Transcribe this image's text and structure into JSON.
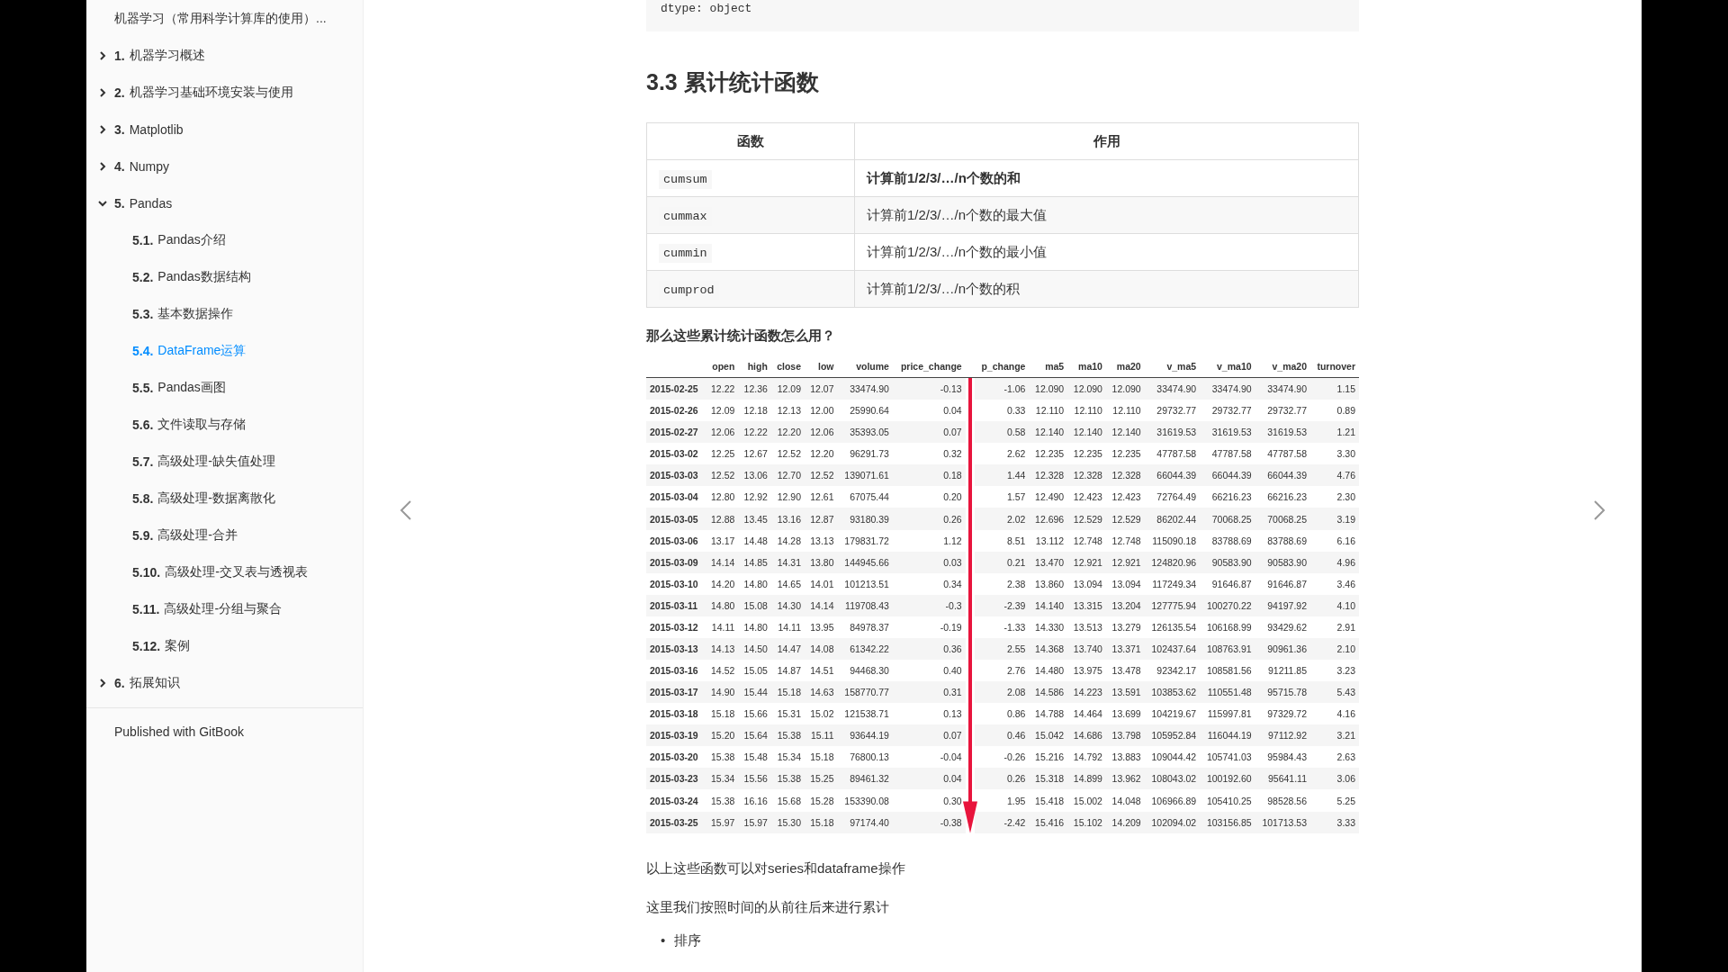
{
  "sidebar": {
    "header": "机器学习（常用科学计算库的使用）...",
    "items": [
      {
        "number": "1.",
        "label": "机器学习概述",
        "expanded": false,
        "selected": false
      },
      {
        "number": "2.",
        "label": "机器学习基础环境安装与使用",
        "expanded": false,
        "selected": false
      },
      {
        "number": "3.",
        "label": "Matplotlib",
        "expanded": false,
        "selected": false
      },
      {
        "number": "4.",
        "label": "Numpy",
        "expanded": false,
        "selected": false
      },
      {
        "number": "5.",
        "label": "Pandas",
        "expanded": true,
        "selected": false,
        "children": [
          {
            "number": "5.1.",
            "label": "Pandas介绍",
            "selected": false
          },
          {
            "number": "5.2.",
            "label": "Pandas数据结构",
            "selected": false
          },
          {
            "number": "5.3.",
            "label": "基本数据操作",
            "selected": false
          },
          {
            "number": "5.4.",
            "label": "DataFrame运算",
            "selected": true
          },
          {
            "number": "5.5.",
            "label": "Pandas画图",
            "selected": false
          },
          {
            "number": "5.6.",
            "label": "文件读取与存储",
            "selected": false
          },
          {
            "number": "5.7.",
            "label": "高级处理-缺失值处理",
            "selected": false
          },
          {
            "number": "5.8.",
            "label": "高级处理-数据离散化",
            "selected": false
          },
          {
            "number": "5.9.",
            "label": "高级处理-合并",
            "selected": false
          },
          {
            "number": "5.10.",
            "label": "高级处理-交叉表与透视表",
            "selected": false
          },
          {
            "number": "5.11.",
            "label": "高级处理-分组与聚合",
            "selected": false
          },
          {
            "number": "5.12.",
            "label": "案例",
            "selected": false
          }
        ]
      },
      {
        "number": "6.",
        "label": "拓展知识",
        "expanded": false,
        "selected": false
      }
    ],
    "footer": "Published with GitBook"
  },
  "content": {
    "code": "dtype: object",
    "heading": "3.3 累计统计函数",
    "function_table": {
      "columns": [
        "函数",
        "作用"
      ],
      "rows": [
        {
          "function": "cumsum",
          "description": "计算前1/2/3/…/n个数的和",
          "bold": true
        },
        {
          "function": "cummax",
          "description": "计算前1/2/3/…/n个数的最大值",
          "bold": false
        },
        {
          "function": "cummin",
          "description": "计算前1/2/3/…/n个数的最小值",
          "bold": false
        },
        {
          "function": "cumprod",
          "description": "计算前1/2/3/…/n个数的积",
          "bold": false
        }
      ]
    },
    "question": "那么这些累计统计函数怎么用？",
    "dataframe": {
      "columns": [
        "open",
        "high",
        "close",
        "low",
        "volume",
        "price_change",
        "p_change",
        "ma5",
        "ma10",
        "ma20",
        "v_ma5",
        "v_ma10",
        "v_ma20",
        "turnover"
      ],
      "rows": [
        {
          "index": "2015-02-25",
          "cells": [
            "12.22",
            "12.36",
            "12.09",
            "12.07",
            "33474.90",
            "-0.13",
            "-1.06",
            "12.090",
            "12.090",
            "12.090",
            "33474.90",
            "33474.90",
            "33474.90",
            "1.15"
          ]
        },
        {
          "index": "2015-02-26",
          "cells": [
            "12.09",
            "12.18",
            "12.13",
            "12.00",
            "25990.64",
            "0.04",
            "0.33",
            "12.110",
            "12.110",
            "12.110",
            "29732.77",
            "29732.77",
            "29732.77",
            "0.89"
          ]
        },
        {
          "index": "2015-02-27",
          "cells": [
            "12.06",
            "12.22",
            "12.20",
            "12.06",
            "35393.05",
            "0.07",
            "0.58",
            "12.140",
            "12.140",
            "12.140",
            "31619.53",
            "31619.53",
            "31619.53",
            "1.21"
          ]
        },
        {
          "index": "2015-03-02",
          "cells": [
            "12.25",
            "12.67",
            "12.52",
            "12.20",
            "96291.73",
            "0.32",
            "2.62",
            "12.235",
            "12.235",
            "12.235",
            "47787.58",
            "47787.58",
            "47787.58",
            "3.30"
          ]
        },
        {
          "index": "2015-03-03",
          "cells": [
            "12.52",
            "13.06",
            "12.70",
            "12.52",
            "139071.61",
            "0.18",
            "1.44",
            "12.328",
            "12.328",
            "12.328",
            "66044.39",
            "66044.39",
            "66044.39",
            "4.76"
          ]
        },
        {
          "index": "2015-03-04",
          "cells": [
            "12.80",
            "12.92",
            "12.90",
            "12.61",
            "67075.44",
            "0.20",
            "1.57",
            "12.490",
            "12.423",
            "12.423",
            "72764.49",
            "66216.23",
            "66216.23",
            "2.30"
          ]
        },
        {
          "index": "2015-03-05",
          "cells": [
            "12.88",
            "13.45",
            "13.16",
            "12.87",
            "93180.39",
            "0.26",
            "2.02",
            "12.696",
            "12.529",
            "12.529",
            "86202.44",
            "70068.25",
            "70068.25",
            "3.19"
          ]
        },
        {
          "index": "2015-03-06",
          "cells": [
            "13.17",
            "14.48",
            "14.28",
            "13.13",
            "179831.72",
            "1.12",
            "8.51",
            "13.112",
            "12.748",
            "12.748",
            "115090.18",
            "83788.69",
            "83788.69",
            "6.16"
          ]
        },
        {
          "index": "2015-03-09",
          "cells": [
            "14.14",
            "14.85",
            "14.31",
            "13.80",
            "144945.66",
            "0.03",
            "0.21",
            "13.470",
            "12.921",
            "12.921",
            "124820.96",
            "90583.90",
            "90583.90",
            "4.96"
          ]
        },
        {
          "index": "2015-03-10",
          "cells": [
            "14.20",
            "14.80",
            "14.65",
            "14.01",
            "101213.51",
            "0.34",
            "2.38",
            "13.860",
            "13.094",
            "13.094",
            "117249.34",
            "91646.87",
            "91646.87",
            "3.46"
          ]
        },
        {
          "index": "2015-03-11",
          "cells": [
            "14.80",
            "15.08",
            "14.30",
            "14.14",
            "119708.43",
            "-0.3",
            "-2.39",
            "14.140",
            "13.315",
            "13.204",
            "127775.94",
            "100270.22",
            "94197.92",
            "4.10"
          ]
        },
        {
          "index": "2015-03-12",
          "cells": [
            "14.11",
            "14.80",
            "14.11",
            "13.95",
            "84978.37",
            "-0.19",
            "-1.33",
            "14.330",
            "13.513",
            "13.279",
            "126135.54",
            "106168.99",
            "93429.62",
            "2.91"
          ]
        },
        {
          "index": "2015-03-13",
          "cells": [
            "14.13",
            "14.50",
            "14.47",
            "14.08",
            "61342.22",
            "0.36",
            "2.55",
            "14.368",
            "13.740",
            "13.371",
            "102437.64",
            "108763.91",
            "90961.36",
            "2.10"
          ]
        },
        {
          "index": "2015-03-16",
          "cells": [
            "14.52",
            "15.05",
            "14.87",
            "14.51",
            "94468.30",
            "0.40",
            "2.76",
            "14.480",
            "13.975",
            "13.478",
            "92342.17",
            "108581.56",
            "91211.85",
            "3.23"
          ]
        },
        {
          "index": "2015-03-17",
          "cells": [
            "14.90",
            "15.44",
            "15.18",
            "14.63",
            "158770.77",
            "0.31",
            "2.08",
            "14.586",
            "14.223",
            "13.591",
            "103853.62",
            "110551.48",
            "95715.78",
            "5.43"
          ]
        },
        {
          "index": "2015-03-18",
          "cells": [
            "15.18",
            "15.66",
            "15.31",
            "15.02",
            "121538.71",
            "0.13",
            "0.86",
            "14.788",
            "14.464",
            "13.699",
            "104219.67",
            "115997.81",
            "97329.72",
            "4.16"
          ]
        },
        {
          "index": "2015-03-19",
          "cells": [
            "15.20",
            "15.64",
            "15.38",
            "15.11",
            "93644.19",
            "0.07",
            "0.46",
            "15.042",
            "14.686",
            "13.798",
            "105952.84",
            "116044.19",
            "97112.92",
            "3.21"
          ]
        },
        {
          "index": "2015-03-20",
          "cells": [
            "15.38",
            "15.48",
            "15.34",
            "15.18",
            "76800.13",
            "-0.04",
            "-0.26",
            "15.216",
            "14.792",
            "13.883",
            "109044.42",
            "105741.03",
            "95984.43",
            "2.63"
          ]
        },
        {
          "index": "2015-03-23",
          "cells": [
            "15.34",
            "15.56",
            "15.38",
            "15.25",
            "89461.32",
            "0.04",
            "0.26",
            "15.318",
            "14.899",
            "13.962",
            "108043.02",
            "100192.60",
            "95641.11",
            "3.06"
          ]
        },
        {
          "index": "2015-03-24",
          "cells": [
            "15.38",
            "16.16",
            "15.68",
            "15.28",
            "153390.08",
            "0.30",
            "1.95",
            "15.418",
            "15.002",
            "14.048",
            "106966.89",
            "105410.25",
            "98528.56",
            "5.25"
          ]
        },
        {
          "index": "2015-03-25",
          "cells": [
            "15.97",
            "15.97",
            "15.30",
            "15.18",
            "97174.40",
            "-0.38",
            "-2.42",
            "15.416",
            "15.102",
            "14.209",
            "102094.02",
            "103156.85",
            "101713.53",
            "3.33"
          ]
        }
      ]
    },
    "paragraphs": [
      "以上这些函数可以对series和dataframe操作",
      "这里我们按照时间的从前往后来进行累计"
    ],
    "bullets": [
      {
        "marker": "•",
        "text": "排序"
      }
    ]
  }
}
